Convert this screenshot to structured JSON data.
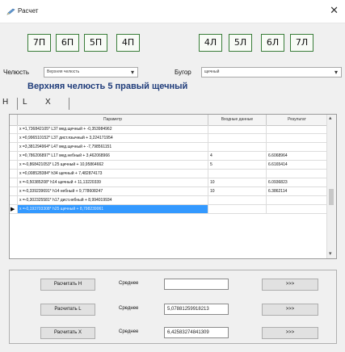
{
  "window": {
    "title": "Расчет",
    "close_glyph": "✕",
    "icon": "pencil-icon"
  },
  "teeth_left": [
    "7П",
    "6П",
    "5П",
    "4П"
  ],
  "teeth_right": [
    "4Л",
    "5Л",
    "6Л",
    "7Л"
  ],
  "jaw": {
    "label": "Челюсть",
    "value": "Верхняя челюсть"
  },
  "tubercle": {
    "label": "Бугор",
    "value": "щечный"
  },
  "heading": "Верхняя челюсть 5 правый щечный",
  "tabs": [
    "H",
    "L",
    "X"
  ],
  "grid": {
    "columns": [
      "Параметр",
      "Входные данные",
      "Результат"
    ],
    "rows": [
      {
        "param": "x =1,736842105* L37 мед.щечный + -0,353984962",
        "input": "",
        "result": ""
      },
      {
        "param": "x =0,996510152* L37 дист.язычный + 3,224171954",
        "input": "",
        "result": ""
      },
      {
        "param": "x =3,381294964* L47 мед.щечный + -7,798561151",
        "input": "",
        "result": ""
      },
      {
        "param": "x =0,786206897* L17 мед.небный + 3,462068966",
        "input": "4",
        "result": "6.6068964"
      },
      {
        "param": "x =-0,868421053* L25 щечный + 10,95864662",
        "input": "5",
        "result": "6.6165414"
      },
      {
        "param": "x =0,008528384* h34 щечный + 7,482874173",
        "input": "",
        "result": ""
      },
      {
        "param": "x =-0,50385208* h14 щечный + 11,13220339",
        "input": "10",
        "result": "6.0936823"
      },
      {
        "param": "x =-0,339239691* h14 небный + 9,778608247",
        "input": "10",
        "result": "6.3862114"
      },
      {
        "param": "x =-0,302325581* h17 дист.небный + 8,994019934",
        "input": "",
        "result": ""
      },
      {
        "param": "x =-0,19370330​8* h25 щечный + 8,798239061",
        "input": "",
        "result": ""
      }
    ],
    "selected_row": 9
  },
  "calc": {
    "avg_label": "Среднее",
    "go_label": ">>>",
    "rows": [
      {
        "button": "Расчитать H",
        "value": ""
      },
      {
        "button": "Расчитать L",
        "value": "5,07881259918213"
      },
      {
        "button": "Расчитать X",
        "value": "6,42583274841309"
      }
    ]
  },
  "colors": {
    "tooth_border": "#3a7d3a",
    "heading": "#1f3c7a",
    "selection": "#3399ff"
  }
}
